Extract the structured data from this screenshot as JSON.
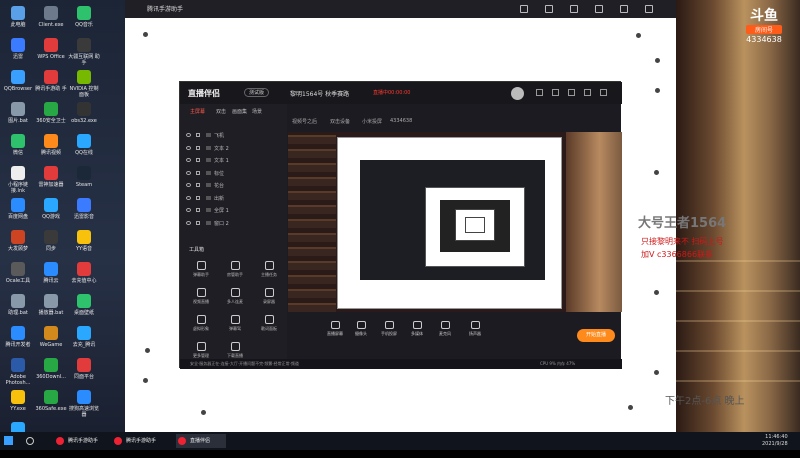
{
  "desktop_icons": [
    {
      "label": "此电脑",
      "color": "#5aa0e8"
    },
    {
      "label": "Client.exe",
      "color": "#6c7a8c"
    },
    {
      "label": "QQ音乐",
      "color": "#2dc26b"
    },
    {
      "label": "迅雷",
      "color": "#3b7bff"
    },
    {
      "label": "WPS Office",
      "color": "#e23b3b"
    },
    {
      "label": "大疆互联网 助手",
      "color": "#3a3a3a"
    },
    {
      "label": "QQBrowser",
      "color": "#3aa0ff"
    },
    {
      "label": "腾讯手游助 手",
      "color": "#e23b3b"
    },
    {
      "label": "NVIDIA 控制 面板",
      "color": "#76b900"
    },
    {
      "label": "图片.bat",
      "color": "#8899aa"
    },
    {
      "label": "360安全卫士",
      "color": "#27a845"
    },
    {
      "label": "obs32.exe",
      "color": "#333333"
    },
    {
      "label": "微信",
      "color": "#2dc26b"
    },
    {
      "label": "腾讯视频",
      "color": "#ff8a1c"
    },
    {
      "label": "QQ在线",
      "color": "#2aa8ff"
    },
    {
      "label": "小程序链接.lnk",
      "color": "#eeeeee"
    },
    {
      "label": "雷神加速器",
      "color": "#e23b3b"
    },
    {
      "label": "Steam",
      "color": "#1b2838"
    },
    {
      "label": "百度网盘",
      "color": "#2a8cff"
    },
    {
      "label": "QQ游戏",
      "color": "#2aa8ff"
    },
    {
      "label": "迅雷影音",
      "color": "#3b7bff"
    },
    {
      "label": "大发顾梦",
      "color": "#cc4422"
    },
    {
      "label": "同步",
      "color": "#3a3a3a"
    },
    {
      "label": "YY语音",
      "color": "#f7c10c"
    },
    {
      "label": "Ocale工具",
      "color": "#5a5a5a"
    },
    {
      "label": "腾讯云",
      "color": "#2a8cff"
    },
    {
      "label": "去充值中心",
      "color": "#e23b3b"
    },
    {
      "label": "助理.bat",
      "color": "#8899aa"
    },
    {
      "label": "播放器.bat",
      "color": "#8899aa"
    },
    {
      "label": "桌面壁纸",
      "color": "#2dc26b"
    },
    {
      "label": "腾讯开发者",
      "color": "#2a8cff"
    },
    {
      "label": "WeGame",
      "color": "#d28a1c"
    },
    {
      "label": "去充_腾讯",
      "color": "#2aa8ff"
    },
    {
      "label": "Adobe Photosh...",
      "color": "#2a5aa8"
    },
    {
      "label": "360Downl...",
      "color": "#27a845"
    },
    {
      "label": "同面平台",
      "color": "#e23b3b"
    },
    {
      "label": "YY.exe",
      "color": "#f7c10c"
    },
    {
      "label": "360Safe.exe",
      "color": "#27a845"
    },
    {
      "label": "搜狗高速浏览器",
      "color": "#2a8cff"
    },
    {
      "label": "腾讯QQ",
      "color": "#2aa8ff"
    }
  ],
  "top_window": {
    "title": "腾讯手游助手"
  },
  "app": {
    "name": "直播伴侣",
    "version_badge": "测试版",
    "project": "黎明1564号 秋季赛路",
    "live_status": "直播中00:00:00",
    "tabs": [
      "主屏幕",
      "双击",
      "画面集",
      "场景"
    ],
    "sources": [
      "飞机",
      "文本 2",
      "文本 1",
      "标位",
      "花台",
      "出新",
      "全屏 1",
      "窗口 2"
    ],
    "tools_title": "工具箱",
    "tools": [
      "弹幕助手",
      "房管助手",
      "主播任务",
      "视频直播",
      "多人连麦",
      "录屏器",
      "虚拟形象",
      "弹幕驾",
      "歌词面板",
      "更多管理",
      "下载直播"
    ],
    "sub_header": [
      "视频号之后",
      "双击设备",
      "小米投屏",
      "4334638"
    ],
    "controls": [
      "直播屏幕",
      "摄像头",
      "手机投屏",
      "多媒体",
      "麦克风",
      "扬声器"
    ],
    "start_button": "开始直播",
    "status_left": "安全·服务器正在·连接·大厅·开播问题不完·频繁·经常正常·频道",
    "status_right": "CPU 9% 内存 47%"
  },
  "overlay": {
    "streamer_name": "大号王者1564",
    "line1": "只接黎明来不 扫码上号",
    "line2": "加V c3366866联系",
    "schedule": "下午2点-6点 晚上"
  },
  "douyu": {
    "logo": "斗鱼",
    "room_label": "房间号",
    "room_number": "4334638"
  },
  "taskbar": {
    "items": [
      "腾讯手游助手",
      "腾讯手游助手",
      "直播伴侣"
    ],
    "time": "11:46:40",
    "date": "2021/9/28"
  }
}
